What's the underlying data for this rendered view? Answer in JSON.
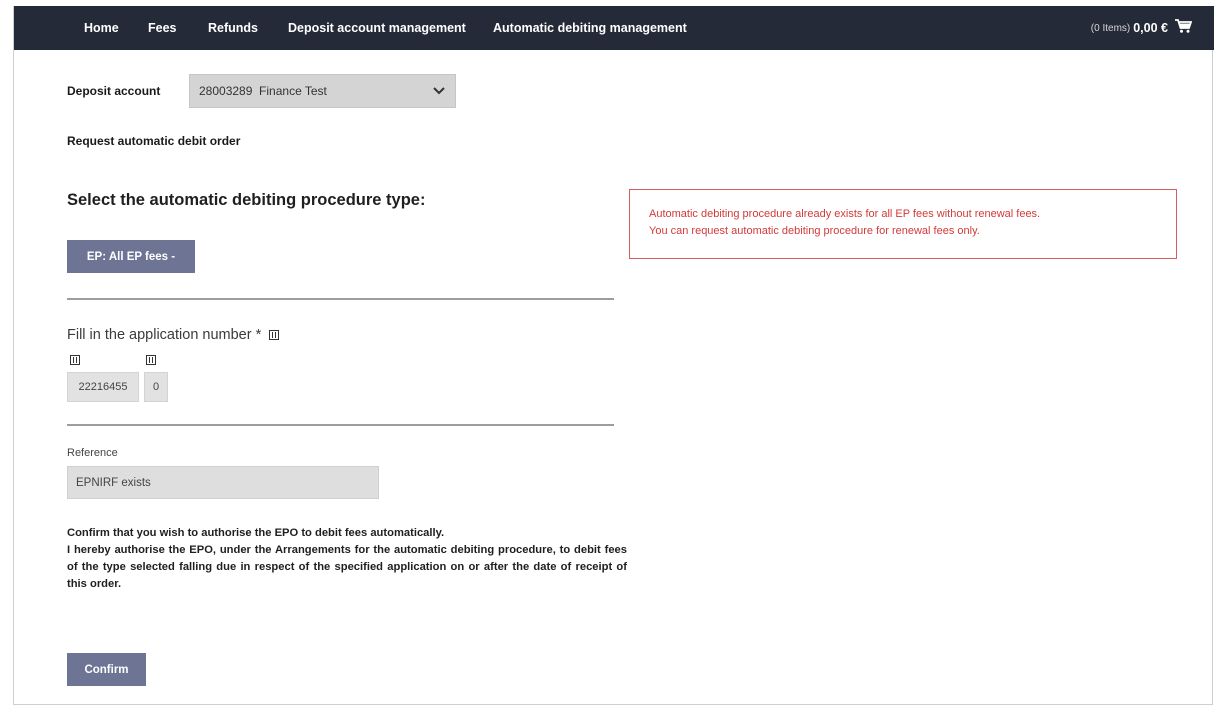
{
  "nav": {
    "items": [
      "Home",
      "Fees",
      "Refunds",
      "Deposit account management",
      "Automatic debiting management"
    ],
    "cart": {
      "items_label": "(0 Items)",
      "amount": "0,00 €",
      "icon": "cart-icon"
    }
  },
  "deposit": {
    "label": "Deposit account",
    "selected": "28003289  Finance Test",
    "icon": "chevron-down-icon"
  },
  "request_title": "Request automatic debit order",
  "procedure": {
    "heading": "Select the automatic debiting procedure type:",
    "button_label": "EP: All EP fees -"
  },
  "application": {
    "label": "Fill in the application number *",
    "number": "22216455",
    "check_digit": "0",
    "info_icon": "info-icon"
  },
  "reference": {
    "label": "Reference",
    "value": "EPNIRF exists"
  },
  "confirmation": {
    "line1": "Confirm that you wish to authorise the EPO to debit fees automatically.",
    "line2": "I hereby authorise the EPO, under the Arrangements for the automatic debiting procedure, to debit fees of the type selected falling due in respect of the specified application on or after the date of receipt of this order.",
    "button_label": "Confirm"
  },
  "alert": {
    "line1": "Automatic debiting procedure already exists for all EP fees without renewal fees.",
    "line2": "You can request automatic debiting procedure for renewal fees only.",
    "color": "#d23a3a"
  },
  "colors": {
    "nav_bg": "#252a38",
    "button_bg": "#6e7594",
    "alert_border": "#d55d5d"
  }
}
